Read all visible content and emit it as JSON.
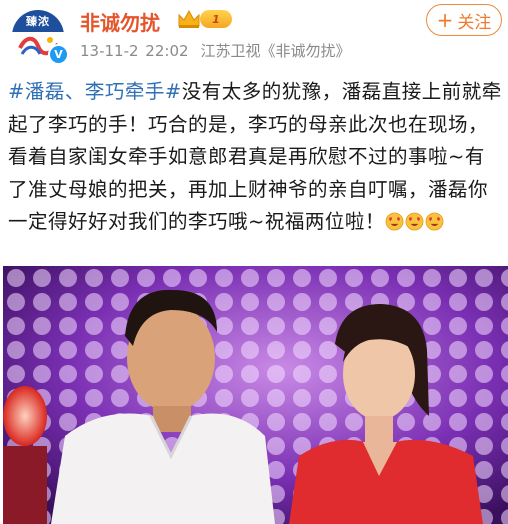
{
  "post": {
    "author": {
      "name": "非诚勿扰",
      "avatar_label": "臻浓",
      "level": "1",
      "verified_icon": "verified-v-icon",
      "crown_icon": "crown-icon"
    },
    "meta": {
      "time": "13-11-2 22:02",
      "source": "江苏卫视《非诚勿扰》"
    },
    "follow_label": "关注",
    "text": {
      "hashtag": "#潘磊、李巧牵手#",
      "body": "没有太多的犹豫，潘磊直接上前就牵起了李巧的手！巧合的是，李巧的母亲此次也在现场，看着自家闺女牵手如意郎君真是再欣慰不过的事啦~有了准丈母娘的把关，再加上财神爷的亲自叮嘱，潘磊你一定得好好对我们的李巧哦~祝福两位啦！"
    },
    "emojis": [
      "heart-eyes-emoji",
      "heart-eyes-emoji",
      "heart-eyes-emoji"
    ]
  },
  "colors": {
    "brand_orange": "#e5552b",
    "hashtag_blue": "#2f6fb5",
    "verify_blue": "#1e9bf0"
  }
}
